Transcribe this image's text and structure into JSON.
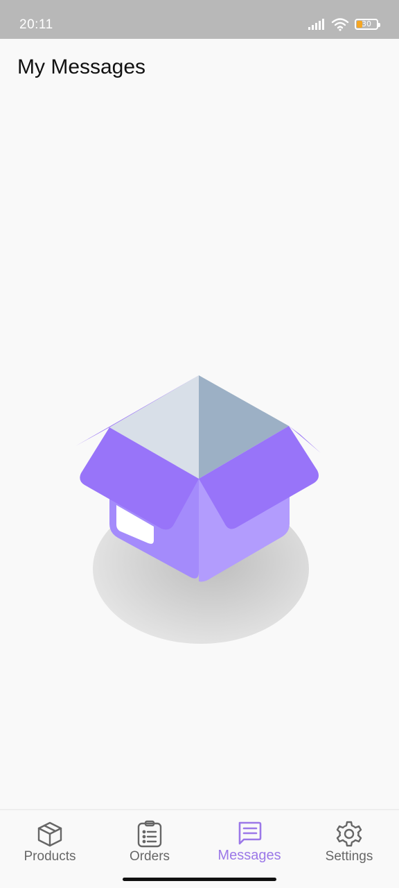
{
  "status_bar": {
    "time": "20:11",
    "battery_level": "30",
    "icons": [
      "signal-icon",
      "wifi-icon",
      "battery-icon"
    ],
    "battery_color": "#f5a623"
  },
  "header": {
    "title": "My Messages"
  },
  "empty_state": {
    "illustration": "open-box-illustration"
  },
  "tab_bar": {
    "tabs": [
      {
        "label": "Products",
        "icon": "box-icon",
        "active": false
      },
      {
        "label": "Orders",
        "icon": "clipboard-list-icon",
        "active": false
      },
      {
        "label": "Messages",
        "icon": "chat-bubble-icon",
        "active": true
      },
      {
        "label": "Settings",
        "icon": "gear-icon",
        "active": false
      }
    ],
    "active_color": "#9b78e8",
    "inactive_color": "#666666"
  }
}
